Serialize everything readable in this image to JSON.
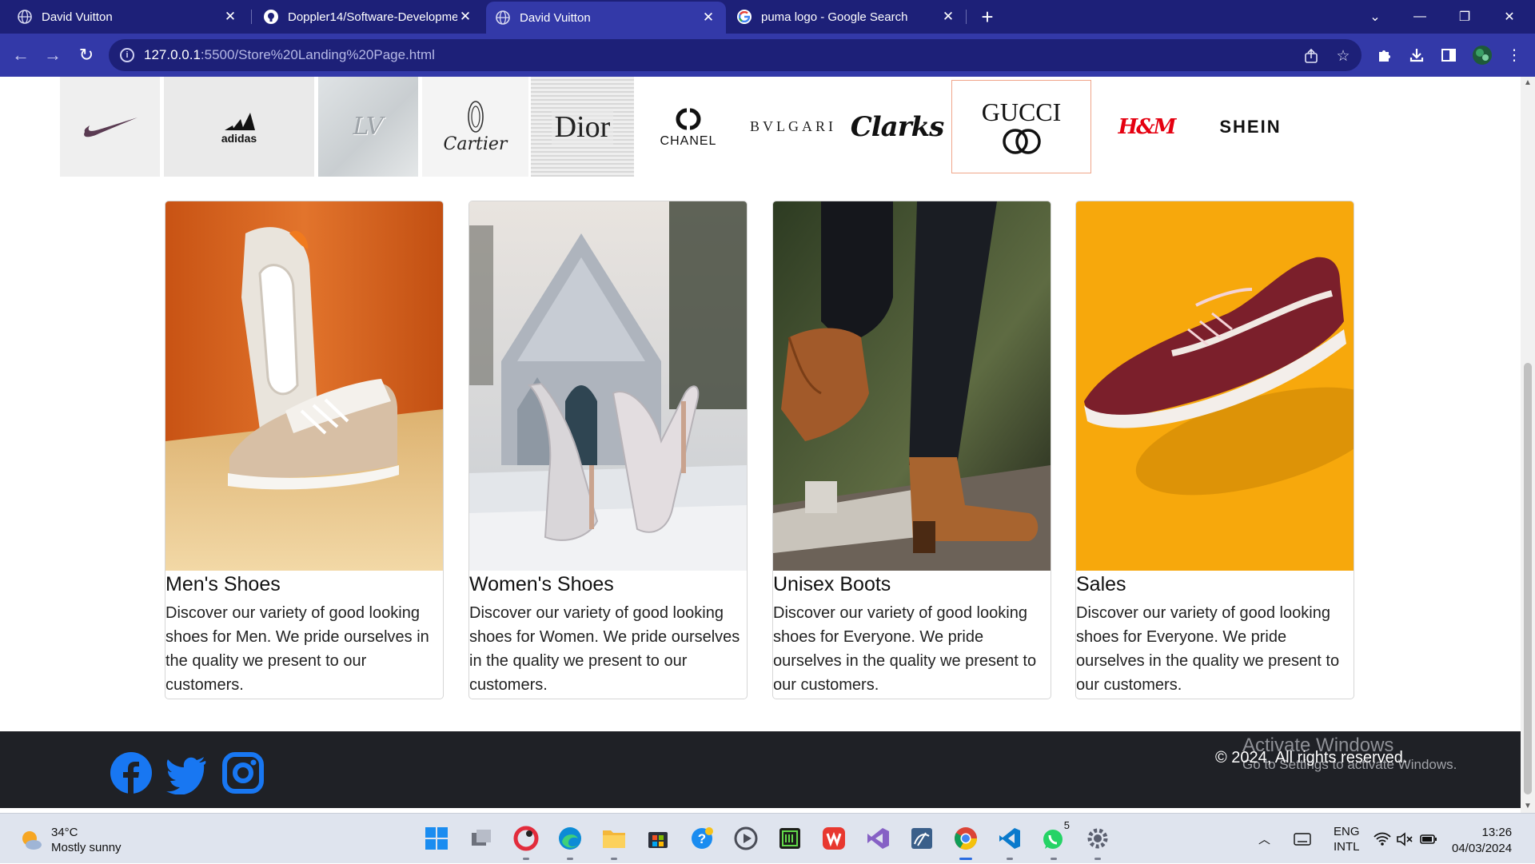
{
  "browser": {
    "tabs": [
      {
        "title": "David Vuitton",
        "icon": "globe-icon",
        "active": false
      },
      {
        "title": "Doppler14/Software-Developme",
        "icon": "github-icon",
        "active": false
      },
      {
        "title": "David Vuitton",
        "icon": "globe-icon",
        "active": true
      },
      {
        "title": "puma logo - Google Search",
        "icon": "google-icon",
        "active": false
      }
    ],
    "new_tab_label": "+",
    "close_glyph": "✕",
    "address": {
      "host": "127.0.0.1",
      "path": ":5500/Store%20Landing%20Page.html"
    },
    "nav": {
      "back": "←",
      "forward": "→",
      "reload": "↻"
    }
  },
  "brands": [
    {
      "name": "nike-logo",
      "text": ""
    },
    {
      "name": "adidas-logo",
      "text": "adidas"
    },
    {
      "name": "louis-vuitton-logo",
      "text": "LV"
    },
    {
      "name": "cartier-logo",
      "text": "Cartier"
    },
    {
      "name": "dior-logo",
      "text": "Dior"
    },
    {
      "name": "chanel-logo",
      "text": "CHANEL"
    },
    {
      "name": "bvlgari-logo",
      "text": "BVLGARI"
    },
    {
      "name": "clarks-logo",
      "text": "Clarks"
    },
    {
      "name": "gucci-logo",
      "text": "GUCCI"
    },
    {
      "name": "hm-logo",
      "text": "H&M"
    },
    {
      "name": "shein-logo",
      "text": "SHEIN"
    }
  ],
  "cards": [
    {
      "title": "Men's Shoes",
      "text": "Discover our variety of good looking shoes for Men. We pride ourselves in the quality we present to our customers."
    },
    {
      "title": "Women's Shoes",
      "text": "Discover our variety of good looking shoes for Women. We pride ourselves in the quality we present to our customers."
    },
    {
      "title": "Unisex Boots",
      "text": "Discover our variety of good looking shoes for Everyone. We pride ourselves in the quality we present to our customers."
    },
    {
      "title": "Sales",
      "text": "Discover our variety of good looking shoes for Everyone. We pride ourselves in the quality we present to our customers."
    }
  ],
  "footer": {
    "copyright": "© 2024, All rights reserved.",
    "social": [
      "facebook-icon",
      "twitter-icon",
      "instagram-icon"
    ],
    "watermark_title": "Activate Windows",
    "watermark_sub": "Go to Settings to activate Windows."
  },
  "taskbar": {
    "weather_temp": "34°C",
    "weather_desc": "Mostly sunny",
    "language": "ENG",
    "layout": "INTL",
    "time": "13:26",
    "date": "04/03/2024",
    "whatsapp_badge": "5"
  },
  "colors": {
    "tabbar": "#1d2078",
    "toolbar": "#3339a8",
    "footer": "#1f2126",
    "social": "#1877f2",
    "taskbar": "#dfe4ee"
  }
}
